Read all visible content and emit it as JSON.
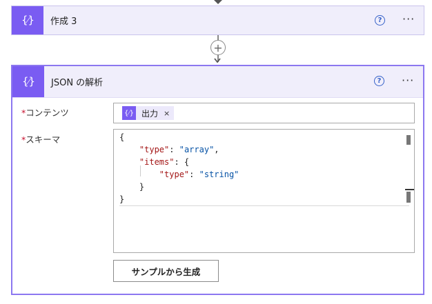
{
  "compose_card": {
    "title": "作成 3",
    "help_glyph": "?",
    "more_glyph": "···"
  },
  "add_step_glyph": "+",
  "parse_card": {
    "title": "JSON の解析",
    "help_glyph": "?",
    "more_glyph": "···",
    "content_field": {
      "required_mark": "*",
      "label": "コンテンツ",
      "token_label": "出力",
      "token_remove": "×"
    },
    "schema_field": {
      "required_mark": "*",
      "label": "スキーマ",
      "code": {
        "l1": "{",
        "l2_key": "\"type\"",
        "l2_sep": ": ",
        "l2_val": "\"array\"",
        "l2_end": ",",
        "l3_key": "\"items\"",
        "l3_sep": ": {",
        "l4_key": "\"type\"",
        "l4_sep": ": ",
        "l4_val": "\"string\"",
        "l5": "}",
        "l6": "}"
      }
    },
    "generate_button_label": "サンプルから生成"
  },
  "icons": {
    "action_icon": "expression-braces-icon",
    "help": "help-circle-icon",
    "more": "more-horizontal-icon"
  },
  "colors": {
    "accent": "#7a5cf2",
    "card_header_bg": "#f0eefb",
    "selected_border": "#8c77f0",
    "help_blue": "#3561c9",
    "required_red": "#c8102e"
  }
}
